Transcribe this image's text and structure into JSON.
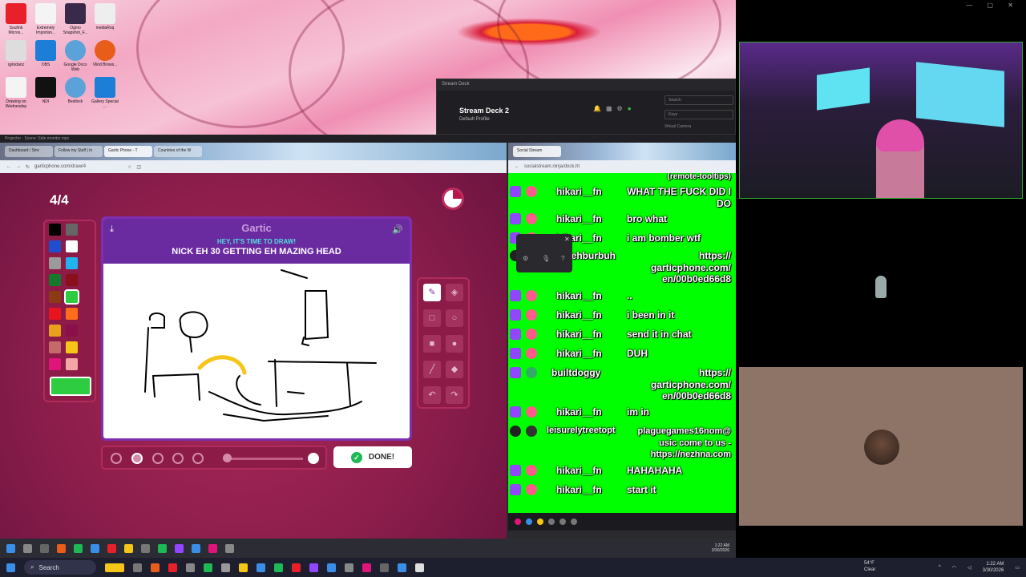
{
  "projector": {
    "title": "Projector - Scene: Side monitor mpc"
  },
  "stream_deck": {
    "window_title": "Stream Deck",
    "device": "Stream Deck 2",
    "profile": "Default Profile",
    "search_placeholder": "Search",
    "keys_label": "Keys",
    "virtual_label": "Virtual Camera"
  },
  "browser_left": {
    "tabs": [
      "Dashboard / Stre",
      "Follow my Stuff | In",
      "Gartic Phone - T",
      "Countries of the W"
    ],
    "url": "garticphone.com/draw/4"
  },
  "gartic": {
    "round": "4/4",
    "logo": "Gartic",
    "subtitle": "HEY, IT'S TIME TO DRAW!",
    "prompt": "NICK EH 30 GETTING EH MAZING HEAD",
    "done_label": "DONE!",
    "colors": [
      "#000000",
      "#666666",
      "#1f4fd1",
      "#ffffff",
      "#9a9a9a",
      "#20b3f0",
      "#137a2b",
      "#8b0f1a",
      "#8a3b14",
      "#2ecc40",
      "#e8151e",
      "#ff6d1a",
      "#e8a11a",
      "#8a0f4a",
      "#c46a6a",
      "#f5c518",
      "#e0157a",
      "#f5a5a5"
    ],
    "selected_color": "#2ecc40"
  },
  "browser_right": {
    "tab": "Social Stream",
    "url": "socialstream.ninja/dock.ht"
  },
  "chat": {
    "top_partial": "(remote-tooltips)",
    "messages": [
      {
        "user": "hikari__fn",
        "text": "WHAT THE FUCK DID I DO"
      },
      {
        "user": "hikari__fn",
        "text": "bro what"
      },
      {
        "user": "hikari__fn",
        "text": "i am bomber wtf"
      },
      {
        "user": "blehburbuh",
        "text": "https:// garticphone.com/ en/00b0ed66d8"
      },
      {
        "user": "hikari__fn",
        "text": ".."
      },
      {
        "user": "hikari__fn",
        "text": "i been in it"
      },
      {
        "user": "hikari__fn",
        "text": "send it in chat"
      },
      {
        "user": "hikari__fn",
        "text": "DUH"
      },
      {
        "user": "builtdoggy",
        "text": "https:// garticphone.com/ en/00b0ed66d8"
      },
      {
        "user": "hikari__fn",
        "text": "im in"
      },
      {
        "user": "leisurelytreetopt",
        "text": "plaguegames16nom@ usic come to us - https://nezhna.com"
      },
      {
        "user": "hikari__fn",
        "text": "HAHAHAHA"
      },
      {
        "user": "hikari__fn",
        "text": "start it"
      }
    ]
  },
  "desktop_icons": [
    "SoulInk Micros...",
    "Extremely Importan...",
    "Ogmo Snapshot_F...",
    "mediaRoq",
    "qytodanz",
    "OBS",
    "Google Docs Web",
    "Vlind Brows...",
    "Drawing on Wednesday",
    "NDI",
    "Bestlock",
    "Gallery Special ..."
  ],
  "taskbar": {
    "search": "Search",
    "weather_temp": "54°F",
    "weather_desc": "Clear",
    "time": "1:22 AM",
    "date": "3/30/2026"
  },
  "inner_taskbar": {
    "time": "1:22 AM",
    "date": "3/30/2026"
  }
}
